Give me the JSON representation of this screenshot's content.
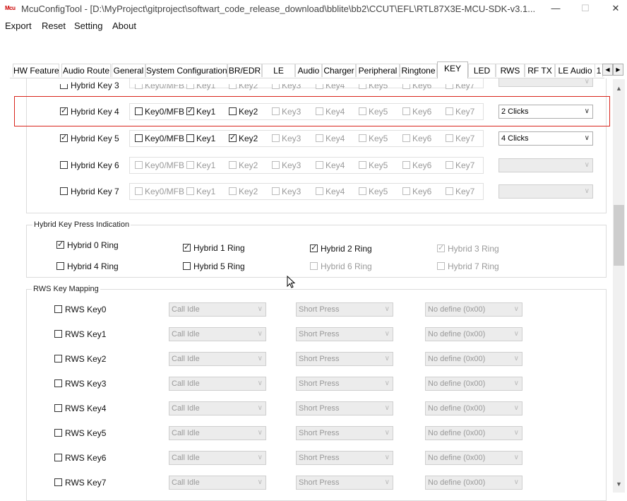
{
  "window": {
    "title": "McuConfigTool - [D:\\MyProject\\gitproject\\softwart_code_release_download\\bblite\\bb2\\CCUT\\EFL\\RTL87X3E-MCU-SDK-v3.1...",
    "icon_text": "Mcu",
    "minimize": "—",
    "maximize": "☐",
    "close": "✕"
  },
  "menu": [
    "Export",
    "Reset",
    "Setting",
    "About"
  ],
  "tabs": [
    "HW Feature",
    "Audio Route",
    "General",
    "System Configuration",
    "BR/EDR",
    "LE",
    "Audio",
    "Charger",
    "Peripheral",
    "Ringtone",
    "KEY",
    "LED",
    "RWS",
    "RF TX",
    "LE Audio",
    "1"
  ],
  "active_tab": "KEY",
  "scroll_arrows": {
    "left": "◀",
    "right": "▶",
    "up": "▲",
    "down": "▼"
  },
  "key_labels": [
    "Key0/MFB",
    "Key1",
    "Key2",
    "Key3",
    "Key4",
    "Key5",
    "Key6",
    "Key7"
  ],
  "hybrid_rows": [
    {
      "label": "Hybrid Key 3",
      "enabled": false,
      "checks": [
        false,
        false,
        false,
        false,
        false,
        false,
        false,
        false
      ],
      "combo": ""
    },
    {
      "label": "Hybrid Key 4",
      "enabled": true,
      "checked": true,
      "checks": [
        false,
        true,
        false,
        false,
        false,
        false,
        false,
        false
      ],
      "combo": "2 Clicks"
    },
    {
      "label": "Hybrid Key 5",
      "enabled": true,
      "checked": true,
      "checks": [
        false,
        false,
        true,
        false,
        false,
        false,
        false,
        false
      ],
      "combo": "4 Clicks"
    },
    {
      "label": "Hybrid Key 6",
      "enabled": false,
      "checked": false,
      "checks": [
        false,
        false,
        false,
        false,
        false,
        false,
        false,
        false
      ],
      "combo": ""
    },
    {
      "label": "Hybrid Key 7",
      "enabled": false,
      "checked": false,
      "checks": [
        false,
        false,
        false,
        false,
        false,
        false,
        false,
        false
      ],
      "combo": ""
    }
  ],
  "press_indication": {
    "title": "Hybrid Key Press Indication",
    "items": [
      {
        "label": "Hybrid 0 Ring",
        "checked": true,
        "enabled": true
      },
      {
        "label": "Hybrid 1 Ring",
        "checked": true,
        "enabled": true
      },
      {
        "label": "Hybrid 2 Ring",
        "checked": true,
        "enabled": true
      },
      {
        "label": "Hybrid 3 Ring",
        "checked": true,
        "enabled": false
      },
      {
        "label": "Hybrid 4 Ring",
        "checked": false,
        "enabled": true
      },
      {
        "label": "Hybrid 5 Ring",
        "checked": false,
        "enabled": true
      },
      {
        "label": "Hybrid 6 Ring",
        "checked": false,
        "enabled": false
      },
      {
        "label": "Hybrid 7 Ring",
        "checked": false,
        "enabled": false
      }
    ]
  },
  "rws_mapping": {
    "title": "RWS Key Mapping",
    "rows": [
      {
        "label": "RWS Key0",
        "state": "Call Idle",
        "press": "Short Press",
        "action": "No define  (0x00)"
      },
      {
        "label": "RWS Key1",
        "state": "Call Idle",
        "press": "Short Press",
        "action": "No define  (0x00)"
      },
      {
        "label": "RWS Key2",
        "state": "Call Idle",
        "press": "Short Press",
        "action": "No define  (0x00)"
      },
      {
        "label": "RWS Key3",
        "state": "Call Idle",
        "press": "Short Press",
        "action": "No define  (0x00)"
      },
      {
        "label": "RWS Key4",
        "state": "Call Idle",
        "press": "Short Press",
        "action": "No define  (0x00)"
      },
      {
        "label": "RWS Key5",
        "state": "Call Idle",
        "press": "Short Press",
        "action": "No define  (0x00)"
      },
      {
        "label": "RWS Key6",
        "state": "Call Idle",
        "press": "Short Press",
        "action": "No define  (0x00)"
      },
      {
        "label": "RWS Key7",
        "state": "Call Idle",
        "press": "Short Press",
        "action": "No define  (0x00)"
      }
    ]
  },
  "colors": {
    "highlight": "#d9251c",
    "disabled_text": "#9a9a9a"
  }
}
